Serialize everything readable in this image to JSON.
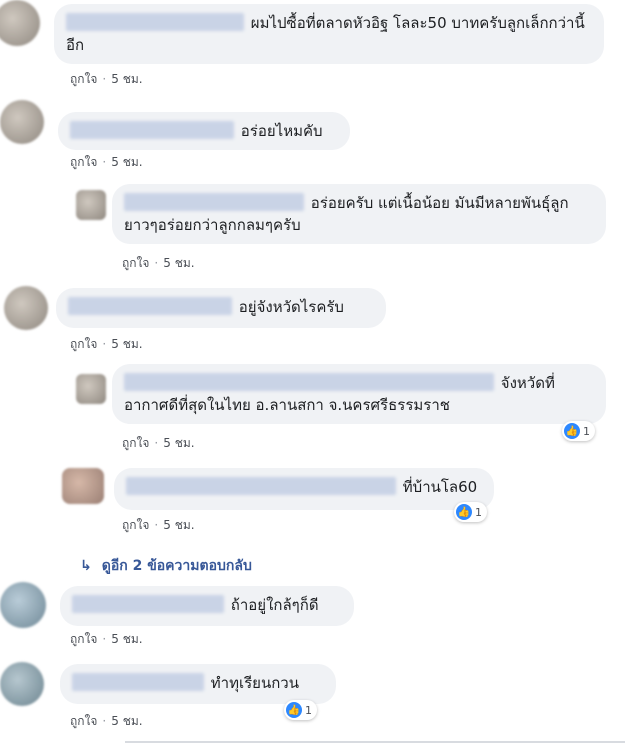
{
  "comments": [
    {
      "text": "ผมไปซื้อที่ตลาดหัวอิฐ โลละ50 บาทครับลูกเล็กกว่านี้อีก",
      "like": "ถูกใจ",
      "time": "5 ชม."
    },
    {
      "text": "อร่อยไหมคับ",
      "like": "ถูกใจ",
      "time": "5 ชม."
    },
    {
      "text": "อร่อยครับ แต่เนื้อน้อย มันมีหลายพันธุ์ลูกยาวๆอร่อยกว่าลูกกลมๆครับ",
      "like": "ถูกใจ",
      "time": "5 ชม."
    },
    {
      "text": "อยู่จังหวัดไรครับ",
      "like": "ถูกใจ",
      "time": "5 ชม."
    },
    {
      "text": "จังหวัดที่อากาศดีที่สุดในไทย อ.ลานสกา จ.นครศรีธรรมราช",
      "like": "ถูกใจ",
      "time": "5 ชม.",
      "reactions": "1"
    },
    {
      "text": "ที่บ้านโล60",
      "like": "ถูกใจ",
      "time": "5 ชม.",
      "reactions": "1"
    },
    {
      "text": "ถ้าอยู่ใกล้ๆก็ดี",
      "like": "ถูกใจ",
      "time": "5 ชม."
    },
    {
      "text": "ทำทุเรียนกวน",
      "like": "ถูกใจ",
      "time": "5 ชม.",
      "reactions": "1"
    }
  ],
  "more_replies": "ดูอีก 2 ข้อความตอบกลับ",
  "colors": {
    "bubble": "#f0f2f5",
    "link": "#385898",
    "reaction": "#2d88ff"
  }
}
